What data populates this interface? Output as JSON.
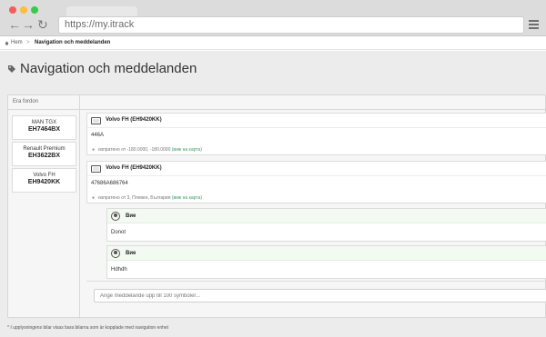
{
  "browser": {
    "url": "https://my.itrack",
    "back_icon": "arrow-left-icon",
    "forward_icon": "arrow-right-icon",
    "reload_icon": "reload-icon",
    "menu_icon": "hamburger-icon"
  },
  "breadcrumb": {
    "home": "Hem",
    "separator": ">",
    "current": "Navigation och meddelanden"
  },
  "page": {
    "title": "Navigation och meddelanden",
    "title_icon": "tag-icon"
  },
  "vehicles_panel": {
    "header": "Era fordon",
    "items": [
      {
        "name": "MAN TGX",
        "plate": "EH7464BX"
      },
      {
        "name": "Renault Premium",
        "plate": "EH3622BX"
      },
      {
        "name": "Volvo FH",
        "plate": "EH9420KK"
      }
    ]
  },
  "messages": [
    {
      "vehicle": "Volvo FH (EH9420KK)",
      "body": "446A",
      "location": "изпратено от -180.0000, -180.0000",
      "map_link": "(виж на карта)"
    },
    {
      "vehicle": "Volvo FH (EH9420KK)",
      "body": "47686A686764",
      "location": "изпратено от 3, Плевен, България",
      "map_link": "(виж на карта)"
    }
  ],
  "replies": [
    {
      "author": "Вие",
      "text": "Donot"
    },
    {
      "author": "Вие",
      "text": "Hdhdh"
    }
  ],
  "compose": {
    "placeholder": "Ange meddelande upp till 100 symboler..."
  },
  "footnote": "* I upplysningens bilar visas bara bilarna som är kopplade med navigation enhet",
  "colors": {
    "link": "#3f9d62",
    "reply_header": "#f3faf1",
    "page_bg": "#ececec"
  }
}
